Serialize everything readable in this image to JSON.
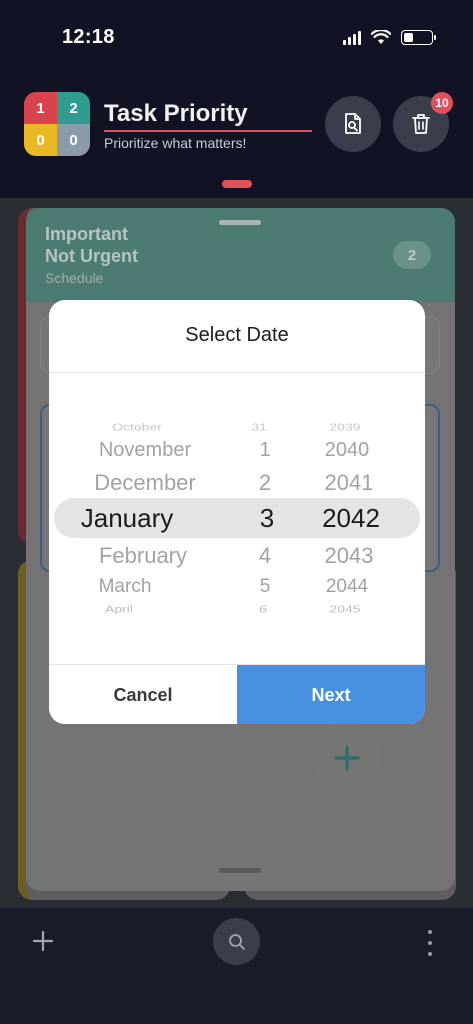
{
  "status": {
    "time": "12:18",
    "battery_level": 0.35
  },
  "header": {
    "logo_cells": [
      {
        "value": "1",
        "color": "#d9434d"
      },
      {
        "value": "2",
        "color": "#2e9c8f"
      },
      {
        "value": "0",
        "color": "#e8b923"
      },
      {
        "value": "0",
        "color": "#8a9aa8"
      }
    ],
    "title": "Task Priority",
    "subtitle": "Prioritize what matters!",
    "trash_badge": "10"
  },
  "quadrant": {
    "title": "Important\nNot Urgent",
    "subtitle": "Schedule",
    "count": "2"
  },
  "modal": {
    "title": "Select Date",
    "months": [
      "October",
      "November",
      "December",
      "January",
      "February",
      "March",
      "April"
    ],
    "days": [
      "31",
      "1",
      "2",
      "3",
      "4",
      "5",
      "6"
    ],
    "years": [
      "2039",
      "2040",
      "2041",
      "2042",
      "2043",
      "2044",
      "2045"
    ],
    "selected": {
      "month": "January",
      "day": "3",
      "year": "2042"
    },
    "cancel_label": "Cancel",
    "next_label": "Next"
  },
  "colors": {
    "accent_red": "#e0505c",
    "accent_blue": "#4a90e2",
    "quadrant_green": "#2e9c8f"
  }
}
